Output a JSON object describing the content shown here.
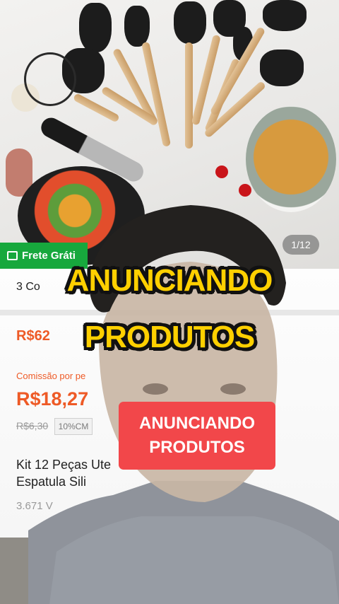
{
  "photo": {
    "badge_label": "Frete Gráti",
    "image_counter": "1/12"
  },
  "listing": {
    "title_short": "3 Co",
    "price": "R$62",
    "commission_label": "Comissão por pe",
    "commission_value": "R$18,27",
    "old_price": "R$6,30",
    "percent_tag": "10%CM",
    "description_line1": "Kit 12 Peças Ute",
    "description_line2": "Espatula Sili",
    "sold_count": "3.671 V"
  },
  "overlay": {
    "caption_line1": "ANUNCIANDO",
    "caption_line2": "PRODUTOS",
    "box_line1": "ANUNCIANDO",
    "box_line2": "PRODUTOS"
  },
  "colors": {
    "caption_yellow": "#ffd000",
    "badge_green": "#17a83d",
    "price_orange": "#ee5a26",
    "box_red": "#f2474a"
  }
}
